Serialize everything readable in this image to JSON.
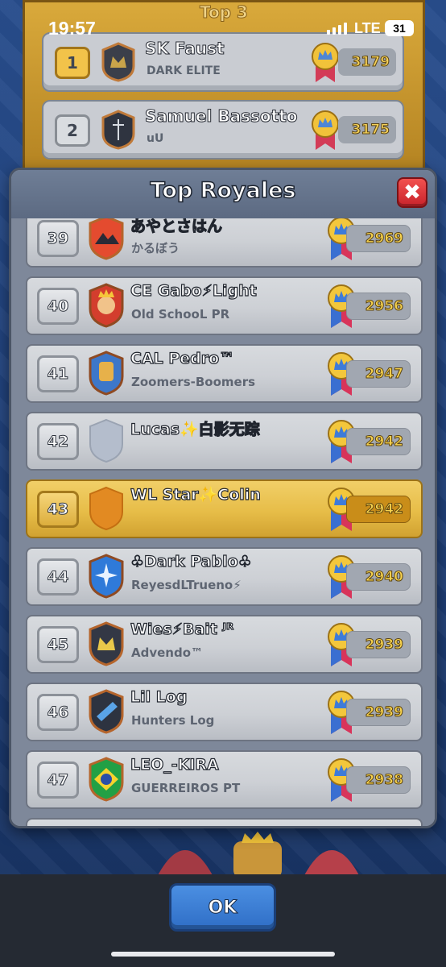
{
  "status_bar": {
    "time": "19:57",
    "network": "LTE",
    "battery": "31"
  },
  "background_panel": {
    "title": "Top 3",
    "rows": [
      {
        "rank": "1",
        "name": "SK Faust",
        "clan": "DARK ELITE",
        "trophies": "3179"
      },
      {
        "rank": "2",
        "name": "Samuel Bassotto",
        "clan": "uU",
        "trophies": "3175"
      }
    ]
  },
  "modal": {
    "title": "Top Royales",
    "close_label": "✖",
    "rows": [
      {
        "rank": "39",
        "name": "あやとさはん",
        "clan": "かるぼう",
        "trophies": "2969"
      },
      {
        "rank": "40",
        "name": "CE Gabo⚡Light",
        "clan": "Old SchooL PR",
        "trophies": "2956"
      },
      {
        "rank": "41",
        "name": "CAL Pedro™",
        "clan": "Zoomers-Boomers",
        "trophies": "2947"
      },
      {
        "rank": "42",
        "name": "Lucas✨白影无踪",
        "clan": "",
        "trophies": "2942"
      },
      {
        "rank": "43",
        "name": "WL Star✨Colin",
        "clan": "",
        "trophies": "2942"
      },
      {
        "rank": "44",
        "name": "♧Dark Pablo♧",
        "clan": "ReyesdLTrueno⚡",
        "trophies": "2940"
      },
      {
        "rank": "45",
        "name": "Wies⚡Bait ᴶᴿ",
        "clan": "Advendo™",
        "trophies": "2939"
      },
      {
        "rank": "46",
        "name": "Lil Log",
        "clan": "Hunters Log",
        "trophies": "2939"
      },
      {
        "rank": "47",
        "name": "LEO_-KIRA",
        "clan": "GUERREIROS PT",
        "trophies": "2938"
      }
    ]
  },
  "ok_label": "OK",
  "colors": {
    "highlight_row": "#e7bd48",
    "trophy_text": "#f8d44f",
    "close_button": "#d9353a",
    "ok_button": "#3b7dd6"
  }
}
